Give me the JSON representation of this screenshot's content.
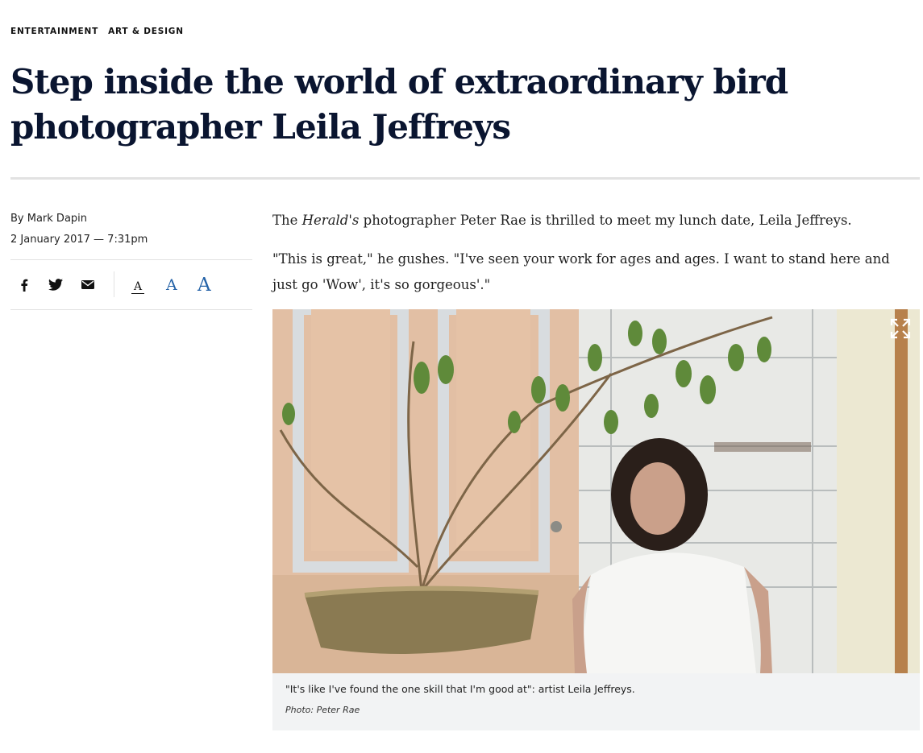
{
  "breadcrumbs": [
    "ENTERTAINMENT",
    "ART & DESIGN"
  ],
  "headline": "Step inside the world of extraordinary bird photographer Leila Jeffreys",
  "byline": {
    "author": "By Mark Dapin",
    "date": "2 January 2017 — 7:31pm"
  },
  "share": {
    "icons": [
      "facebook-icon",
      "twitter-icon",
      "email-icon"
    ]
  },
  "font_size": {
    "small": "A",
    "medium": "A",
    "large": "A"
  },
  "article": {
    "p1_before": "The ",
    "p1_em": "Herald's",
    "p1_after": " photographer Peter Rae is thrilled to meet my lunch date, Leila Jeffreys.",
    "p2": "\"This is great,\" he gushes. \"I've seen your work for ages and ages. I want to stand here and just go 'Wow', it's so gorgeous'.\""
  },
  "figure": {
    "caption": "\"It's like I've found the one skill that I'm good at\": artist Leila Jeffreys.",
    "credit": "Photo: Peter Rae"
  },
  "colors": {
    "headline": "#0a1530",
    "accent": "#2563a8",
    "rule": "#e2e2e2",
    "caption_bg": "#f2f3f4"
  }
}
